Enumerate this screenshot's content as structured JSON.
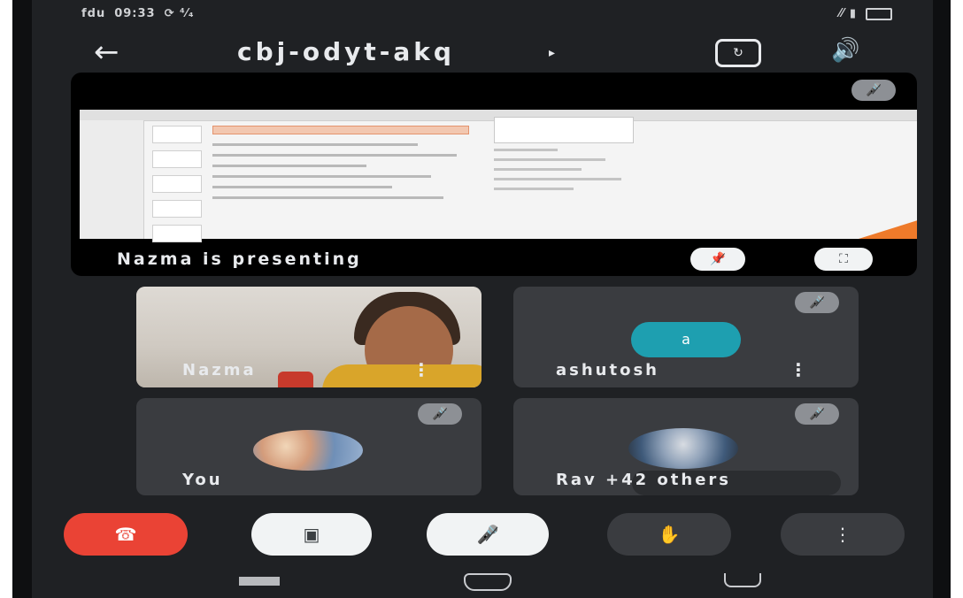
{
  "status_bar": {
    "carrier": "fdu",
    "time": "09:33",
    "extra": "⟳ ⁴⁄₄",
    "signal": "⁄⁄ ▮"
  },
  "meeting": {
    "code": "cbj-odyt-akq",
    "code_arrow": "▸"
  },
  "presentation": {
    "label": "Nazma is presenting",
    "pin_icon": "pin-off-icon",
    "fullscreen_icon": "fullscreen-icon"
  },
  "participants": [
    {
      "name": "Nazma",
      "muted": false,
      "video": true
    },
    {
      "name": "ashutosh",
      "muted": true,
      "video": false,
      "avatar_letter": "a"
    },
    {
      "name": "You",
      "muted": true,
      "video": false
    },
    {
      "name": "Rav",
      "extra": "+42 others",
      "muted": true,
      "video": false
    }
  ],
  "controls": {
    "end_call_icon": "end-call-icon",
    "camera_icon": "camera-off-icon",
    "mic_icon": "mic-off-icon",
    "raise_hand_icon": "raise-hand-icon",
    "more_icon": "more-vertical-icon"
  },
  "colors": {
    "background": "#1f2124",
    "tile": "#3a3c40",
    "end_call": "#ea4335",
    "avatar_teal": "#1e9fb0",
    "pill_light": "#f1f3f4"
  }
}
